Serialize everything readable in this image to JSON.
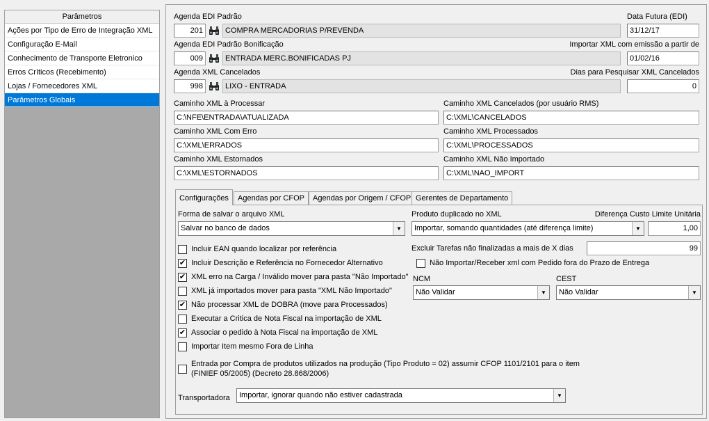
{
  "sidebar": {
    "title": "Parâmetros",
    "items": [
      {
        "label": "Ações por Tipo de Erro de Integração XML",
        "selected": false
      },
      {
        "label": "Configuração E-Mail",
        "selected": false
      },
      {
        "label": "Conhecimento de Transporte Eletronico",
        "selected": false
      },
      {
        "label": "Erros Críticos (Recebimento)",
        "selected": false
      },
      {
        "label": "Lojas / Fornecedores XML",
        "selected": false
      },
      {
        "label": "Parâmetros Globais",
        "selected": true
      }
    ]
  },
  "agenda_edi": {
    "label": "Agenda EDI Padrão",
    "code": "201",
    "description": "COMPRA MERCADORIAS P/REVENDA"
  },
  "data_futura": {
    "label": "Data Futura (EDI)",
    "value": "31/12/17"
  },
  "agenda_bonificacao": {
    "label": "Agenda EDI Padrão Bonificação",
    "code": "009",
    "description": "ENTRADA MERC.BONIFICADAS PJ"
  },
  "importar_xml": {
    "label": "Importar XML com emissão a partir de",
    "value": "01/02/16"
  },
  "agenda_cancelados": {
    "label": "Agenda XML Cancelados",
    "code": "998",
    "description": "LIXO - ENTRADA"
  },
  "dias_pesquisar": {
    "label": "Dias para Pesquisar XML Cancelados",
    "value": "0"
  },
  "paths": {
    "processar": {
      "label": "Caminho XML à Processar",
      "value": "C:\\NFE\\ENTRADA\\ATUALIZADA"
    },
    "cancelados": {
      "label": "Caminho XML Cancelados (por usuário RMS)",
      "value": "C:\\XML\\CANCELADOS"
    },
    "com_erro": {
      "label": "Caminho XML Com Erro",
      "value": "C:\\XML\\ERRADOS"
    },
    "processados": {
      "label": "Caminho XML Processados",
      "value": "C:\\XML\\PROCESSADOS"
    },
    "estornados": {
      "label": "Caminho XML Estornados",
      "value": "C:\\XML\\ESTORNADOS"
    },
    "nao_importado": {
      "label": "Caminho XML Não Importado",
      "value": "C:\\XML\\NAO_IMPORT"
    }
  },
  "tabs": [
    {
      "label": "Configurações",
      "active": true
    },
    {
      "label": "Agendas por CFOP",
      "active": false
    },
    {
      "label": "Agendas por Origem / CFOP",
      "active": false
    },
    {
      "label": "Gerentes de Departamento",
      "active": false
    }
  ],
  "config": {
    "forma_salvar": {
      "label": "Forma de salvar o arquivo XML",
      "value": "Salvar no banco de dados"
    },
    "produto_duplicado": {
      "label": "Produto duplicado no XML",
      "value": "Importar, somando quantidades (até diferença limite)"
    },
    "diferenca_custo": {
      "label": "Diferença Custo Limite Unitária",
      "value": "1,00"
    },
    "excluir_tarefas": {
      "label": "Excluir Tarefas não finalizadas a mais de X dias",
      "value": "99"
    },
    "nao_importar_pedido": {
      "label": "Não Importar/Receber xml com Pedido fora do Prazo de Entrega",
      "checked": false
    },
    "ncm": {
      "label": "NCM",
      "value": "Não Validar"
    },
    "cest": {
      "label": "CEST",
      "value": "Não Validar"
    },
    "checkboxes": [
      {
        "label": "Incluir EAN quando localizar por referência",
        "checked": false
      },
      {
        "label": "Incluir Descrição e Referência no Fornecedor Alternativo",
        "checked": true
      },
      {
        "label": "XML erro na Carga / Inválido mover para pasta \"Não Importado\"",
        "checked": true
      },
      {
        "label": "XML já importados mover para pasta \"XML Não Importado\"",
        "checked": false
      },
      {
        "label": "Não processar XML de DOBRA (move para Processados)",
        "checked": true
      },
      {
        "label": "Executar a Critica de Nota Fiscal na importação de XML",
        "checked": false
      },
      {
        "label": "Associar o pedido à Nota Fiscal na importação de XML",
        "checked": true
      },
      {
        "label": "Importar Item mesmo Fora de Linha",
        "checked": false
      }
    ],
    "entrada_compra": {
      "line1": "Entrada por Compra de produtos utilizados na produção (Tipo Produto = 02) assumir CFOP 1101/2101 para o item",
      "line2": "(FINIEF 05/2005) (Decreto 28.868/2006)",
      "checked": false
    },
    "transportadora": {
      "label": "Transportadora",
      "value": "Importar, ignorar quando não estiver cadastrada"
    }
  },
  "icons": {
    "search": "binoculars-icon",
    "dropdown": "chevron-down-icon",
    "check": "checkmark-icon"
  },
  "colors": {
    "selection": "#0078d7",
    "sidebar_bg": "#a9a9a9",
    "readonly_bg": "#e3e3e3"
  }
}
